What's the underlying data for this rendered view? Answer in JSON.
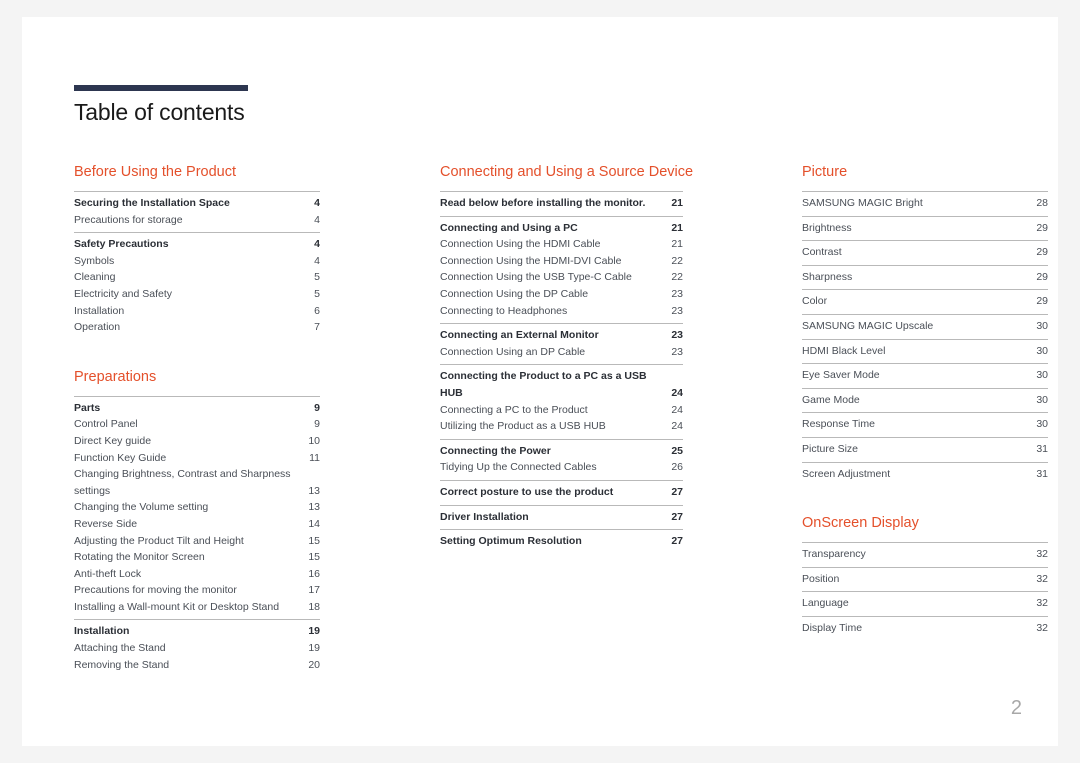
{
  "document": {
    "title": "Table of contents",
    "page_number": "2",
    "accent_color": "#e4502b",
    "rule_color": "#2d3650"
  },
  "columns": [
    {
      "name": "column-1",
      "sections": [
        {
          "title": "Before Using the Product",
          "groups": [
            {
              "entries": [
                {
                  "label": "Securing the Installation Space",
                  "page": "4",
                  "bold": true
                },
                {
                  "label": "Precautions for storage",
                  "page": "4",
                  "bold": false
                }
              ]
            },
            {
              "entries": [
                {
                  "label": "Safety Precautions",
                  "page": "4",
                  "bold": true
                },
                {
                  "label": "Symbols",
                  "page": "4",
                  "bold": false
                },
                {
                  "label": "Cleaning",
                  "page": "5",
                  "bold": false
                },
                {
                  "label": "Electricity and Safety",
                  "page": "5",
                  "bold": false
                },
                {
                  "label": "Installation",
                  "page": "6",
                  "bold": false
                },
                {
                  "label": "Operation",
                  "page": "7",
                  "bold": false
                }
              ]
            }
          ]
        },
        {
          "title": "Preparations",
          "groups": [
            {
              "entries": [
                {
                  "label": "Parts",
                  "page": "9",
                  "bold": true
                },
                {
                  "label": "Control Panel",
                  "page": "9",
                  "bold": false
                },
                {
                  "label": "Direct Key guide",
                  "page": "10",
                  "bold": false
                },
                {
                  "label": "Function Key Guide",
                  "page": "11",
                  "bold": false
                },
                {
                  "label": "Changing Brightness, Contrast and Sharpness settings",
                  "page": "13",
                  "bold": false,
                  "two_line": true
                },
                {
                  "label": "Changing the Volume setting",
                  "page": "13",
                  "bold": false
                },
                {
                  "label": "Reverse Side",
                  "page": "14",
                  "bold": false
                },
                {
                  "label": "Adjusting the Product Tilt and Height",
                  "page": "15",
                  "bold": false
                },
                {
                  "label": "Rotating the Monitor Screen",
                  "page": "15",
                  "bold": false
                },
                {
                  "label": "Anti-theft Lock",
                  "page": "16",
                  "bold": false
                },
                {
                  "label": "Precautions for moving the monitor",
                  "page": "17",
                  "bold": false
                },
                {
                  "label": "Installing a Wall-mount Kit or Desktop Stand",
                  "page": "18",
                  "bold": false
                }
              ]
            },
            {
              "entries": [
                {
                  "label": "Installation",
                  "page": "19",
                  "bold": true
                },
                {
                  "label": "Attaching the Stand",
                  "page": "19",
                  "bold": false
                },
                {
                  "label": "Removing the Stand",
                  "page": "20",
                  "bold": false
                }
              ]
            }
          ]
        }
      ]
    },
    {
      "name": "column-2",
      "sections": [
        {
          "title": "Connecting and Using a Source Device",
          "groups": [
            {
              "entries": [
                {
                  "label": "Read below before installing the monitor.",
                  "page": "21",
                  "bold": true
                }
              ]
            },
            {
              "entries": [
                {
                  "label": "Connecting and Using a PC",
                  "page": "21",
                  "bold": true
                },
                {
                  "label": "Connection Using the HDMI Cable",
                  "page": "21",
                  "bold": false
                },
                {
                  "label": "Connection Using the HDMI-DVI Cable",
                  "page": "22",
                  "bold": false
                },
                {
                  "label": "Connection Using the USB Type-C Cable",
                  "page": "22",
                  "bold": false
                },
                {
                  "label": "Connection Using the DP Cable",
                  "page": "23",
                  "bold": false
                },
                {
                  "label": "Connecting to Headphones",
                  "page": "23",
                  "bold": false
                }
              ]
            },
            {
              "entries": [
                {
                  "label": "Connecting an External Monitor",
                  "page": "23",
                  "bold": true
                },
                {
                  "label": "Connection Using an DP Cable",
                  "page": "23",
                  "bold": false
                }
              ]
            },
            {
              "entries": [
                {
                  "label": "Connecting the Product to a PC as a USB HUB",
                  "page": "24",
                  "bold": true
                },
                {
                  "label": "Connecting a PC to the Product",
                  "page": "24",
                  "bold": false
                },
                {
                  "label": "Utilizing the Product as a USB HUB",
                  "page": "24",
                  "bold": false
                }
              ]
            },
            {
              "entries": [
                {
                  "label": "Connecting the Power",
                  "page": "25",
                  "bold": true
                },
                {
                  "label": "Tidying Up the Connected Cables",
                  "page": "26",
                  "bold": false
                }
              ]
            },
            {
              "entries": [
                {
                  "label": "Correct posture to use the product",
                  "page": "27",
                  "bold": true
                }
              ]
            },
            {
              "entries": [
                {
                  "label": "Driver Installation",
                  "page": "27",
                  "bold": true
                }
              ]
            },
            {
              "entries": [
                {
                  "label": "Setting Optimum Resolution",
                  "page": "27",
                  "bold": true
                }
              ]
            }
          ]
        }
      ]
    },
    {
      "name": "column-3",
      "sections": [
        {
          "title": "Picture",
          "groups": [
            {
              "entries": [
                {
                  "label": "SAMSUNG MAGIC Bright",
                  "page": "28",
                  "bold": false
                }
              ]
            },
            {
              "entries": [
                {
                  "label": "Brightness",
                  "page": "29",
                  "bold": false
                }
              ]
            },
            {
              "entries": [
                {
                  "label": "Contrast",
                  "page": "29",
                  "bold": false
                }
              ]
            },
            {
              "entries": [
                {
                  "label": "Sharpness",
                  "page": "29",
                  "bold": false
                }
              ]
            },
            {
              "entries": [
                {
                  "label": "Color",
                  "page": "29",
                  "bold": false
                }
              ]
            },
            {
              "entries": [
                {
                  "label": "SAMSUNG MAGIC Upscale",
                  "page": "30",
                  "bold": false
                }
              ]
            },
            {
              "entries": [
                {
                  "label": "HDMI Black Level",
                  "page": "30",
                  "bold": false
                }
              ]
            },
            {
              "entries": [
                {
                  "label": "Eye Saver Mode",
                  "page": "30",
                  "bold": false
                }
              ]
            },
            {
              "entries": [
                {
                  "label": "Game Mode",
                  "page": "30",
                  "bold": false
                }
              ]
            },
            {
              "entries": [
                {
                  "label": "Response Time",
                  "page": "30",
                  "bold": false
                }
              ]
            },
            {
              "entries": [
                {
                  "label": "Picture Size",
                  "page": "31",
                  "bold": false
                }
              ]
            },
            {
              "entries": [
                {
                  "label": "Screen Adjustment",
                  "page": "31",
                  "bold": false
                }
              ]
            }
          ]
        },
        {
          "title": "OnScreen Display",
          "groups": [
            {
              "entries": [
                {
                  "label": "Transparency",
                  "page": "32",
                  "bold": false
                }
              ]
            },
            {
              "entries": [
                {
                  "label": "Position",
                  "page": "32",
                  "bold": false
                }
              ]
            },
            {
              "entries": [
                {
                  "label": "Language",
                  "page": "32",
                  "bold": false
                }
              ]
            },
            {
              "entries": [
                {
                  "label": "Display Time",
                  "page": "32",
                  "bold": false
                }
              ]
            }
          ]
        }
      ]
    }
  ]
}
